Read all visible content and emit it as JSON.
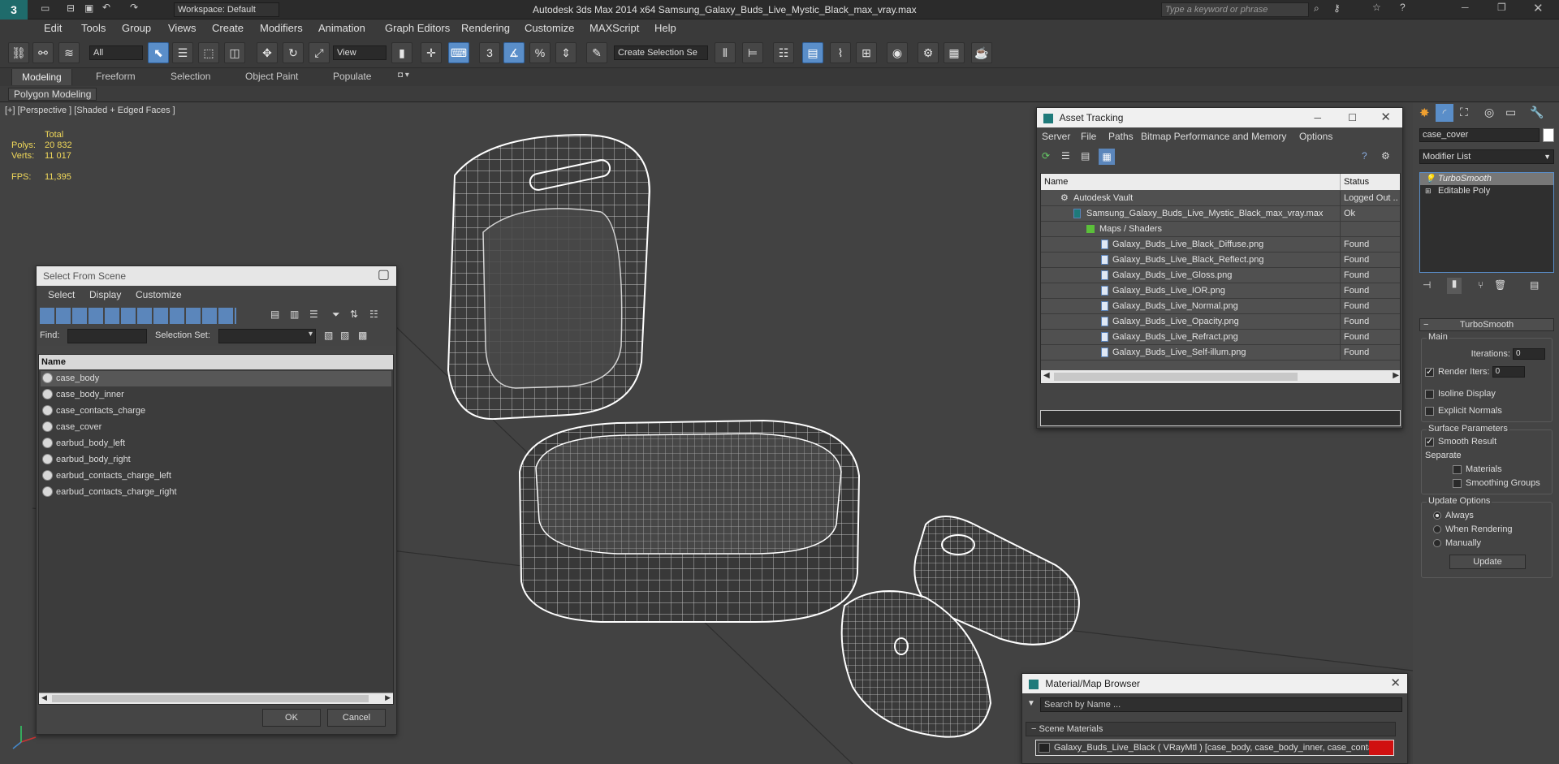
{
  "app": {
    "title": "Autodesk 3ds Max  2014 x64     Samsung_Galaxy_Buds_Live_Mystic_Black_max_vray.max",
    "workspace": "Workspace: Default",
    "search_placeholder": "Type a keyword or phrase"
  },
  "menu": [
    "Edit",
    "Tools",
    "Group",
    "Views",
    "Create",
    "Modifiers",
    "Animation",
    "Graph Editors",
    "Rendering",
    "Customize",
    "MAXScript",
    "Help"
  ],
  "toolbar": {
    "filter_all": "All",
    "view_dropdown": "View",
    "selection_set": "Create Selection Se",
    "snap_3": "3"
  },
  "ribbon": {
    "tabs": [
      "Modeling",
      "Freeform",
      "Selection",
      "Object Paint",
      "Populate"
    ],
    "sub": "Polygon Modeling"
  },
  "viewport": {
    "label": "[+] [Perspective ] [Shaded + Edged Faces ]",
    "stats": {
      "total_label": "Total",
      "polys_label": "Polys:",
      "polys": "20 832",
      "verts_label": "Verts:",
      "verts": "11 017",
      "fps_label": "FPS:",
      "fps": "11,395"
    }
  },
  "select_from_scene": {
    "title": "Select From Scene",
    "menu": [
      "Select",
      "Display",
      "Customize"
    ],
    "find_label": "Find:",
    "selection_set_label": "Selection Set:",
    "column": "Name",
    "items": [
      "case_body",
      "case_body_inner",
      "case_contacts_charge",
      "case_cover",
      "earbud_body_left",
      "earbud_body_right",
      "earbud_contacts_charge_left",
      "earbud_contacts_charge_right"
    ],
    "ok": "OK",
    "cancel": "Cancel"
  },
  "asset_tracking": {
    "title": "Asset Tracking",
    "menu": [
      "Server",
      "File",
      "Paths",
      "Bitmap Performance and Memory",
      "Options"
    ],
    "col_name": "Name",
    "col_status": "Status",
    "rows": [
      {
        "name": "Autodesk Vault",
        "status": "Logged Out ..",
        "indent": 1
      },
      {
        "name": "Samsung_Galaxy_Buds_Live_Mystic_Black_max_vray.max",
        "status": "Ok",
        "indent": 2
      },
      {
        "name": "Maps / Shaders",
        "status": "",
        "indent": 3
      },
      {
        "name": "Galaxy_Buds_Live_Black_Diffuse.png",
        "status": "Found",
        "indent": 4
      },
      {
        "name": "Galaxy_Buds_Live_Black_Reflect.png",
        "status": "Found",
        "indent": 4
      },
      {
        "name": "Galaxy_Buds_Live_Gloss.png",
        "status": "Found",
        "indent": 4
      },
      {
        "name": "Galaxy_Buds_Live_IOR.png",
        "status": "Found",
        "indent": 4
      },
      {
        "name": "Galaxy_Buds_Live_Normal.png",
        "status": "Found",
        "indent": 4
      },
      {
        "name": "Galaxy_Buds_Live_Opacity.png",
        "status": "Found",
        "indent": 4
      },
      {
        "name": "Galaxy_Buds_Live_Refract.png",
        "status": "Found",
        "indent": 4
      },
      {
        "name": "Galaxy_Buds_Live_Self-illum.png",
        "status": "Found",
        "indent": 4
      }
    ]
  },
  "material_browser": {
    "title": "Material/Map Browser",
    "search_placeholder": "Search by Name ...",
    "section": "Scene Materials",
    "item": "Galaxy_Buds_Live_Black  ( VRayMtl ) [case_body, case_body_inner, case_conta..."
  },
  "command_panel": {
    "object_name": "case_cover",
    "modifier_list": "Modifier List",
    "stack": [
      "TurboSmooth",
      "Editable Poly"
    ],
    "rollout_title": "TurboSmooth",
    "main_label": "Main",
    "iterations_label": "Iterations:",
    "iterations": "0",
    "render_iters_label": "Render Iters:",
    "render_iters": "0",
    "isoline": "Isoline Display",
    "explicit_normals": "Explicit Normals",
    "surface_params": "Surface Parameters",
    "smooth_result": "Smooth Result",
    "separate": "Separate",
    "materials": "Materials",
    "smoothing_groups": "Smoothing Groups",
    "update_options": "Update Options",
    "always": "Always",
    "when_rendering": "When Rendering",
    "manually": "Manually",
    "update_btn": "Update"
  }
}
